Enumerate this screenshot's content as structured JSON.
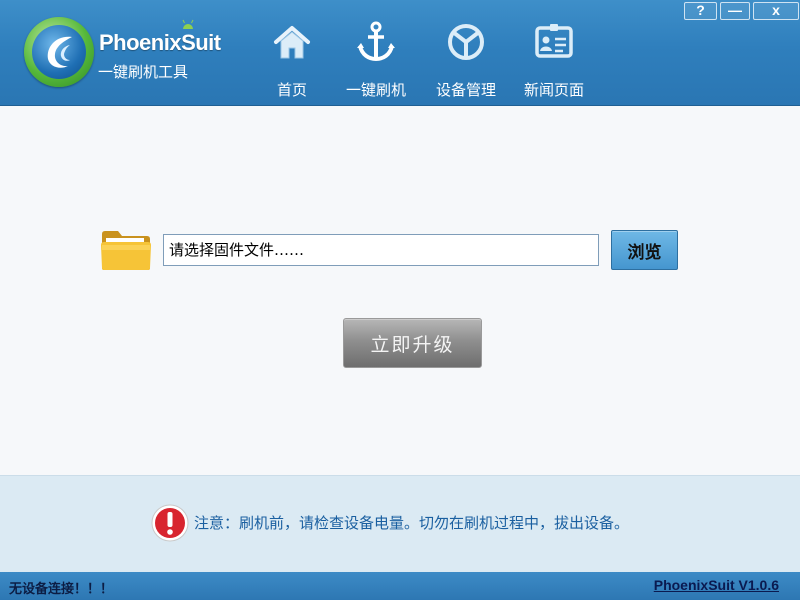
{
  "app": {
    "name": "PhoenixSuit",
    "subtitle": "一键刷机工具"
  },
  "window_buttons": {
    "help": "?",
    "minimize": "—",
    "close": "x"
  },
  "nav": {
    "items": [
      {
        "label": "首页",
        "icon": "home-icon"
      },
      {
        "label": "一键刷机",
        "icon": "anchor-icon"
      },
      {
        "label": "设备管理",
        "icon": "device-icon"
      },
      {
        "label": "新闻页面",
        "icon": "news-icon"
      }
    ]
  },
  "flash": {
    "file_placeholder": "请选择固件文件……",
    "browse_label": "浏览",
    "upgrade_label": "立即升级"
  },
  "notice": {
    "text": "注意：刷机前，请检查设备电量。切勿在刷机过程中，拔出设备。"
  },
  "status": {
    "connection_text": "无设备连接！！！",
    "version_text": "PhoenixSuit V1.0.6"
  },
  "colors": {
    "header_blue": "#2f7fbd",
    "notice_text": "#1a5fa0",
    "notice_band": "#dbeaf3",
    "status_bar": "#2d77b3",
    "browse_blue": "#4596cf"
  }
}
